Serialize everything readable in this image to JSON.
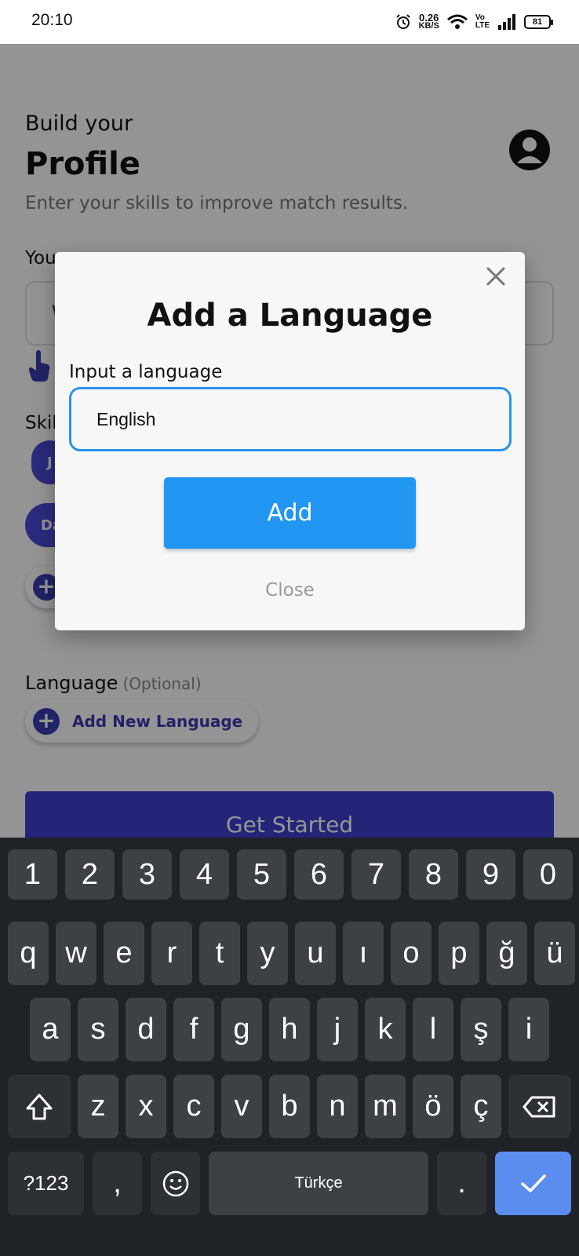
{
  "status_bar": {
    "time": "20:10",
    "speed_value": "0.26",
    "speed_unit": "KB/S",
    "volte_top": "Vo",
    "volte_bottom": "LTE",
    "battery": "81"
  },
  "page": {
    "header_small": "Build your",
    "header_big": "Profile",
    "subtitle": "Enter your skills to improve match results.",
    "your_label": "You",
    "input_partial": "W",
    "skills_label": "Skil",
    "chip_1": "J",
    "chip_2": "Da",
    "language_label": "Language",
    "language_optional": "(Optional)",
    "add_language": "Add New Language",
    "get_started": "Get Started"
  },
  "dialog": {
    "title": "Add a Language",
    "input_label": "Input a language",
    "input_value": "English",
    "add_button": "Add",
    "close_link": "Close"
  },
  "keyboard": {
    "row_numbers": [
      "1",
      "2",
      "3",
      "4",
      "5",
      "6",
      "7",
      "8",
      "9",
      "0"
    ],
    "row_1": [
      "q",
      "w",
      "e",
      "r",
      "t",
      "y",
      "u",
      "ı",
      "o",
      "p",
      "ğ",
      "ü"
    ],
    "row_2": [
      "a",
      "s",
      "d",
      "f",
      "g",
      "h",
      "j",
      "k",
      "l",
      "ş",
      "i"
    ],
    "row_3": [
      "z",
      "x",
      "c",
      "v",
      "b",
      "n",
      "m",
      "ö",
      "ç"
    ],
    "symbols_key": "?123",
    "comma_key": ",",
    "space_label": "Türkçe",
    "period_key": ".",
    "accent_color": "#5b8def"
  },
  "colors": {
    "dialog_input_border": "#2a93e8",
    "add_button": "#2196f3",
    "primary_purple": "#3f3fd1"
  }
}
